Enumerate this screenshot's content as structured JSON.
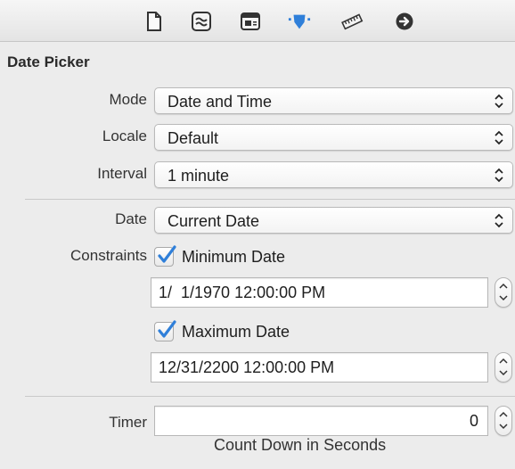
{
  "toolbar": {
    "icons": [
      {
        "name": "file-inspector-icon",
        "active": false
      },
      {
        "name": "quick-help-icon",
        "active": false
      },
      {
        "name": "identity-inspector-icon",
        "active": false
      },
      {
        "name": "attributes-inspector-icon",
        "active": true
      },
      {
        "name": "size-inspector-icon",
        "active": false
      },
      {
        "name": "connections-inspector-icon",
        "active": false
      }
    ]
  },
  "section": {
    "title": "Date Picker"
  },
  "fields": {
    "mode": {
      "label": "Mode",
      "value": "Date and Time"
    },
    "locale": {
      "label": "Locale",
      "value": "Default"
    },
    "interval": {
      "label": "Interval",
      "value": "1 minute"
    },
    "date": {
      "label": "Date",
      "value": "Current Date"
    },
    "constraints": {
      "label": "Constraints",
      "minimum": {
        "label": "Minimum Date",
        "checked": true,
        "value": "1/  1/1970 12:00:00 PM"
      },
      "maximum": {
        "label": "Maximum Date",
        "checked": true,
        "value": "12/31/2200 12:00:00 PM"
      }
    },
    "timer": {
      "label": "Timer",
      "value": "0",
      "caption": "Count Down in Seconds"
    }
  },
  "colors": {
    "accent": "#2f7fd9",
    "background": "#ececec"
  }
}
